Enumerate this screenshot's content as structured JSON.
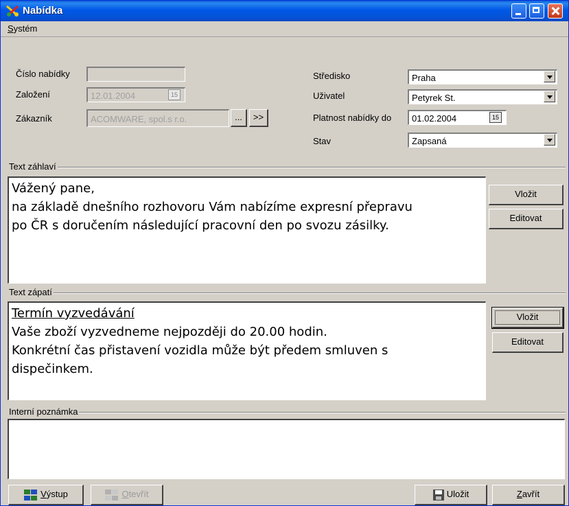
{
  "window": {
    "title": "Nabídka"
  },
  "menu": {
    "system_prefix": "S",
    "system_rest": "ystém"
  },
  "left_form": {
    "cislo_label": "Číslo nabídky",
    "cislo_value": "",
    "zalozeni_label": "Založení",
    "zalozeni_value": "12.01.2004",
    "zakaznik_label": "Zákazník",
    "zakaznik_value": "ACOMWARE, spol.s r.o.",
    "browse_label": "...",
    "goto_label": ">>"
  },
  "right_form": {
    "stredisko_label": "Středisko",
    "stredisko_value": "Praha",
    "uzivatel_label": "Uživatel",
    "uzivatel_value": "Petyrek St.",
    "platnost_label": "Platnost nabídky do",
    "platnost_value": "01.02.2004",
    "stav_label": "Stav",
    "stav_value": "Zapsaná"
  },
  "calendar_glyph": "15",
  "header_section": {
    "label": "Text záhlaví",
    "lines": [
      "Vážený pane,",
      "na základě dnešního rozhovoru Vám nabízíme expresní přepravu",
      "po ČR s doručením následující pracovní den po svozu zásilky."
    ],
    "insert_label": "Vložit",
    "edit_label": "Editovat"
  },
  "footer_section": {
    "label": "Text zápatí",
    "heading": "Termín vyzvedávání",
    "lines": [
      "Vaše zboží vyzvedneme nejpozději do 20.00 hodin.",
      "Konkrétní čas přistavení vozidla může být předem smluven s",
      "dispečinkem."
    ],
    "insert_label": "Vložit",
    "edit_label": "Editovat"
  },
  "note_section": {
    "label": "Interní poznámka",
    "value": ""
  },
  "bottom": {
    "vystup_prefix": "V",
    "vystup_rest": "ýstup",
    "otevrit_prefix": "O",
    "otevrit_rest": "tevřít",
    "ulozit_label": "Uložit",
    "zavrit_prefix": "Z",
    "zavrit_rest": "avřít"
  }
}
